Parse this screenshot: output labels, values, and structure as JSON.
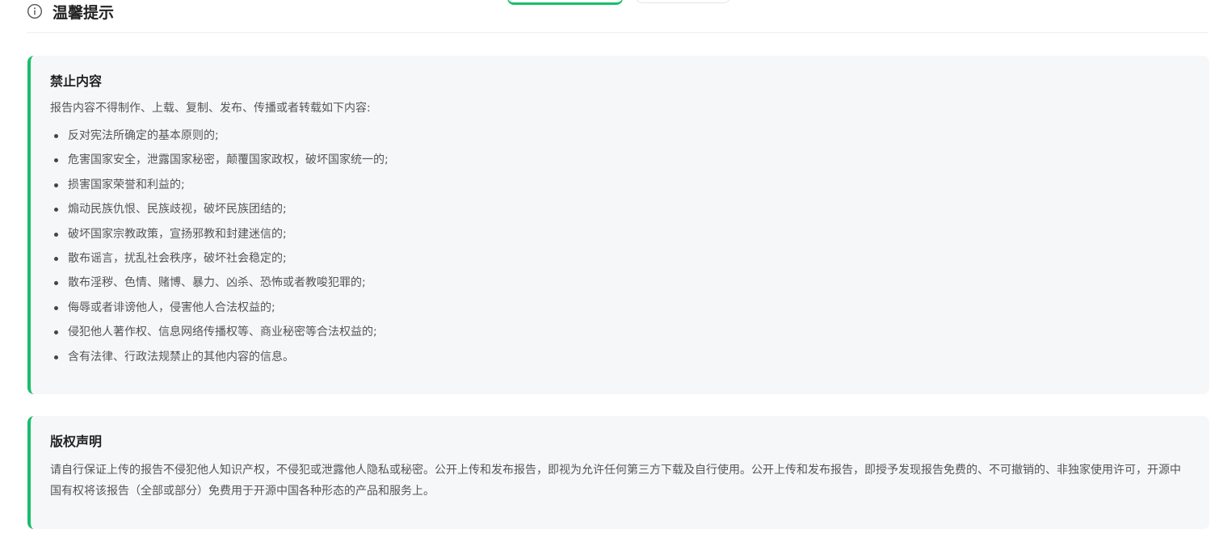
{
  "header": {
    "icon": "info-icon",
    "title": "温馨提示"
  },
  "prohibited": {
    "title": "禁止内容",
    "intro": "报告内容不得制作、上载、复制、发布、传播或者转载如下内容:",
    "items": [
      "反对宪法所确定的基本原则的;",
      "危害国家安全，泄露国家秘密，颠覆国家政权，破坏国家统一的;",
      "损害国家荣誉和利益的;",
      "煽动民族仇恨、民族歧视，破坏民族团结的;",
      "破坏国家宗教政策，宣扬邪教和封建迷信的;",
      "散布谣言，扰乱社会秩序，破坏社会稳定的;",
      "散布淫秽、色情、赌博、暴力、凶杀、恐怖或者教唆犯罪的;",
      "侮辱或者诽谤他人，侵害他人合法权益的;",
      "侵犯他人著作权、信息网络传播权等、商业秘密等合法权益的;",
      "含有法律、行政法规禁止的其他内容的信息。"
    ]
  },
  "copyright": {
    "title": "版权声明",
    "body": "请自行保证上传的报告不侵犯他人知识产权，不侵犯或泄露他人隐私或秘密。公开上传和发布报告，即视为允许任何第三方下载及自行使用。公开上传和发布报告，即授予发现报告免费的、不可撤销的、非独家使用许可，开源中国有权将该报告（全部或部分）免费用于开源中国各种形态的产品和服务上。"
  },
  "colors": {
    "accent": "#19be6b",
    "card_bg": "#f6f7f9"
  }
}
